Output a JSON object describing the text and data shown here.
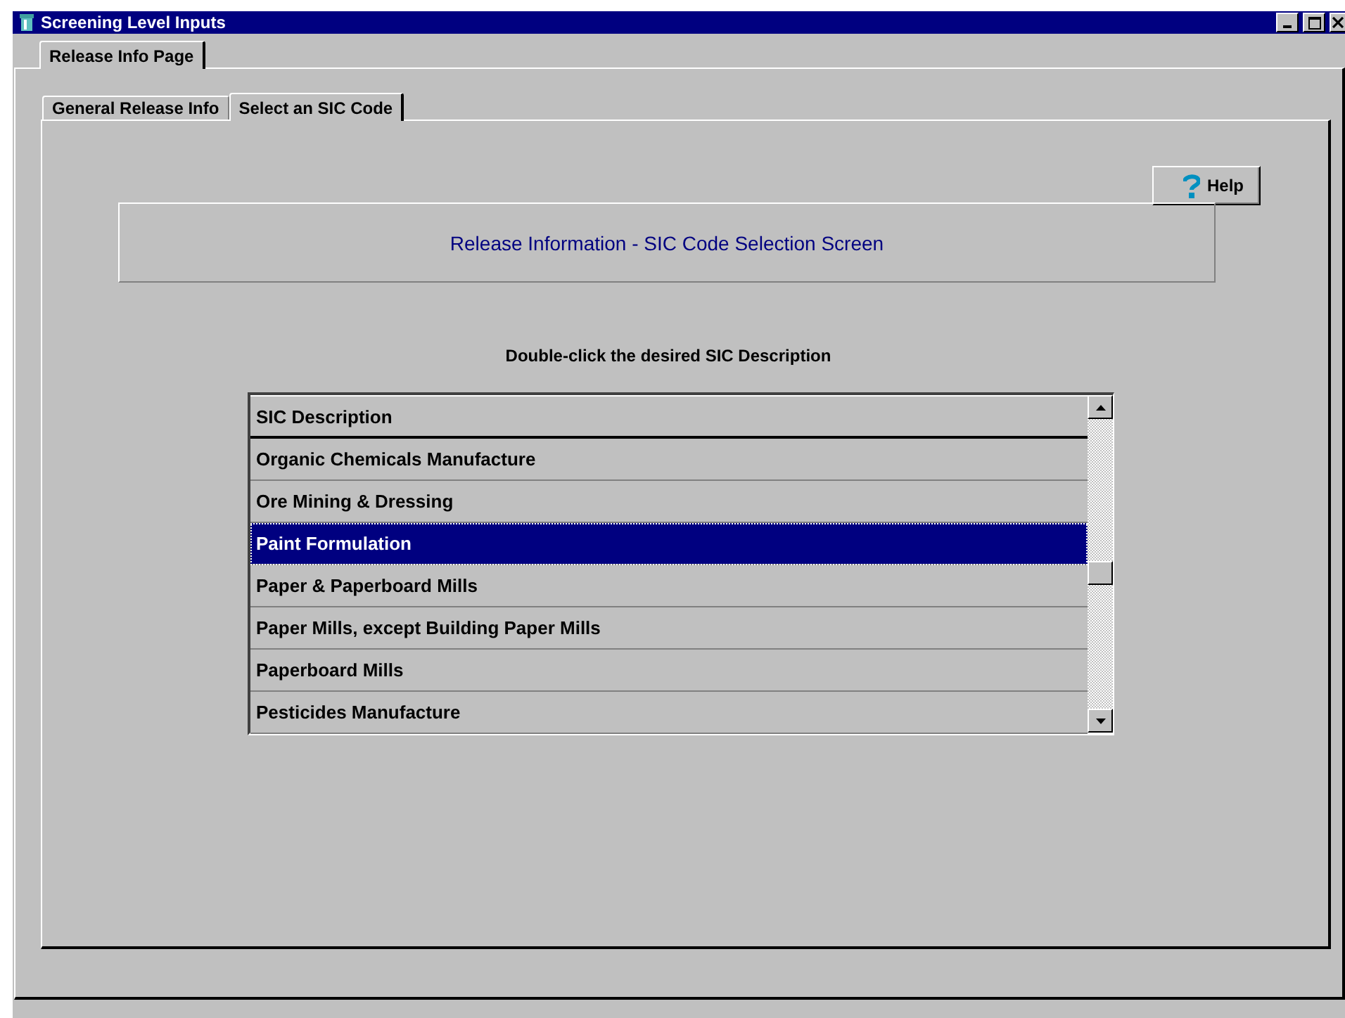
{
  "window": {
    "title": "Screening Level Inputs"
  },
  "outer_tabs": [
    {
      "label": "Release Info Page",
      "selected": true
    }
  ],
  "inner_tabs": [
    {
      "label": "General Release Info",
      "selected": false
    },
    {
      "label": "Select an SIC Code",
      "selected": true
    }
  ],
  "help_button": {
    "label": "Help"
  },
  "header": "Release Information - SIC Code Selection Screen",
  "instruction": "Double-click the desired SIC Description",
  "grid": {
    "columns": [
      "SIC Description"
    ],
    "rows": [
      {
        "cells": [
          "Organic Chemicals Manufacture"
        ],
        "selected": false
      },
      {
        "cells": [
          "Ore Mining & Dressing"
        ],
        "selected": false
      },
      {
        "cells": [
          "Paint Formulation"
        ],
        "selected": true
      },
      {
        "cells": [
          "Paper & Paperboard Mills"
        ],
        "selected": false
      },
      {
        "cells": [
          "Paper Mills, except Building Paper Mills"
        ],
        "selected": false
      },
      {
        "cells": [
          "Paperboard Mills"
        ],
        "selected": false
      },
      {
        "cells": [
          "Pesticides Manufacture"
        ],
        "selected": false
      }
    ]
  }
}
